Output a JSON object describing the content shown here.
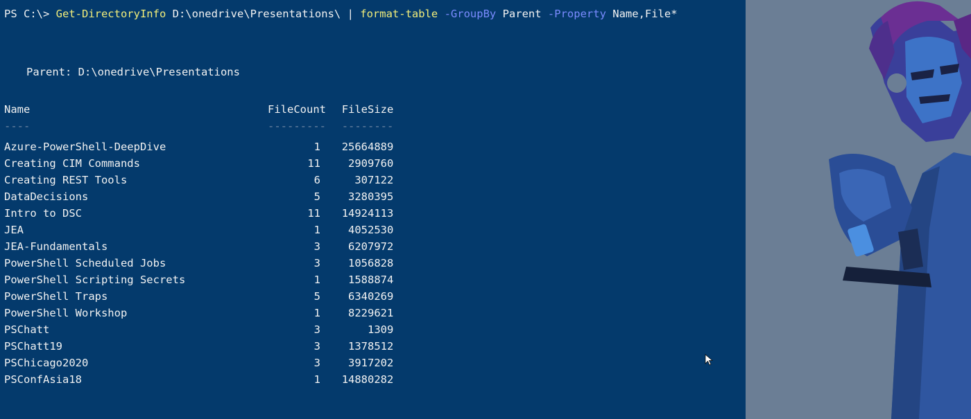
{
  "terminal": {
    "prompt": "PS C:\\> ",
    "command": {
      "cmdlet": "Get-DirectoryInfo",
      "path": " D:\\onedrive\\Presentations\\ ",
      "pipe": "| ",
      "cmdlet2": "format-table",
      "param1": " -GroupBy",
      "value1": " Parent",
      "param2": " -Property",
      "value2": " Name,File*"
    },
    "group_label": "Parent: D:\\onedrive\\Presentations",
    "columns": [
      "Name",
      "FileCount",
      "FileSize"
    ],
    "separators": [
      "----",
      "---------",
      "--------"
    ],
    "rows": [
      {
        "name": "Azure-PowerShell-DeepDive",
        "count": "1",
        "size": "25664889"
      },
      {
        "name": "Creating CIM Commands",
        "count": "11",
        "size": "2909760"
      },
      {
        "name": "Creating REST Tools",
        "count": "6",
        "size": "307122"
      },
      {
        "name": "DataDecisions",
        "count": "5",
        "size": "3280395"
      },
      {
        "name": "Intro to DSC",
        "count": "11",
        "size": "14924113"
      },
      {
        "name": "JEA",
        "count": "1",
        "size": "4052530"
      },
      {
        "name": "JEA-Fundamentals",
        "count": "3",
        "size": "6207972"
      },
      {
        "name": "PowerShell Scheduled Jobs",
        "count": "3",
        "size": "1056828"
      },
      {
        "name": "PowerShell Scripting Secrets",
        "count": "1",
        "size": "1588874"
      },
      {
        "name": "PowerShell Traps",
        "count": "5",
        "size": "6340269"
      },
      {
        "name": "PowerShell Workshop",
        "count": "1",
        "size": "8229621"
      },
      {
        "name": "PSChatt",
        "count": "3",
        "size": "1309"
      },
      {
        "name": "PSChatt19",
        "count": "3",
        "size": "1378512"
      },
      {
        "name": "PSChicago2020",
        "count": "3",
        "size": "3917202"
      },
      {
        "name": "PSConfAsia18",
        "count": "1",
        "size": "14880282"
      }
    ]
  },
  "colors": {
    "background": "#043a6c",
    "text": "#f2f2f2",
    "cmdlet": "#f3ee7a",
    "parameter": "#7a8bff"
  },
  "icons": {
    "background_art": "character-illustration-icon",
    "pointer": "mouse-cursor-icon"
  }
}
